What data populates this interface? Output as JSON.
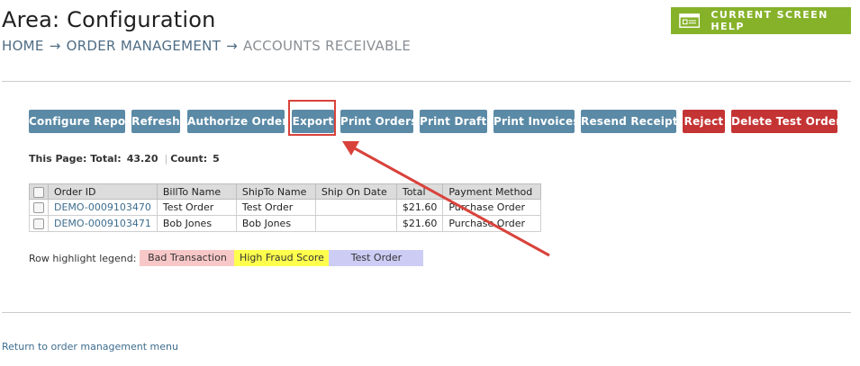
{
  "header": {
    "title": "Area: Configuration",
    "breadcrumb": {
      "home": "HOME",
      "separator": "→",
      "order_management": "ORDER MANAGEMENT",
      "current": "ACCOUNTS RECEIVABLE"
    },
    "help_button": {
      "label": "CURRENT SCREEN HELP",
      "icon": "screen-help-icon"
    }
  },
  "toolbar": {
    "configure_report": "Configure Report",
    "refresh": "Refresh",
    "authorize_orders": "Authorize Orders",
    "export": "Export",
    "print_orders": "Print Orders",
    "print_drafts": "Print Drafts",
    "print_invoices": "Print Invoices",
    "resend_receipts": "Resend Receipts",
    "reject": "Reject",
    "delete_test_orders": "Delete Test Orders"
  },
  "summary": {
    "total_label": "This Page: Total:",
    "total_value": "43.20",
    "count_label": "Count:",
    "count_value": "5"
  },
  "table": {
    "columns": [
      "Order ID",
      "BillTo Name",
      "ShipTo Name",
      "Ship On Date",
      "Total",
      "Payment Method"
    ],
    "rows": [
      {
        "order_id": "DEMO-0009103470",
        "billto": "Test Order",
        "shipto": "Test Order",
        "ship_on": "",
        "total": "$21.60",
        "payment": "Purchase Order"
      },
      {
        "order_id": "DEMO-0009103471",
        "billto": "Bob Jones",
        "shipto": "Bob Jones",
        "ship_on": "",
        "total": "$21.60",
        "payment": "Purchase Order"
      }
    ]
  },
  "legend": {
    "label": "Row highlight legend:",
    "items": [
      {
        "label": "Bad Transaction",
        "color": "#f8c8c8"
      },
      {
        "label": "High Fraud Score",
        "color": "#ffff4d"
      },
      {
        "label": "Test Order",
        "color": "#ccccf5"
      }
    ]
  },
  "footer": {
    "return_link": "Return to order management menu"
  },
  "colors": {
    "help_green": "#86b22a",
    "button_blue": "#5b8aa6",
    "button_red": "#c53434",
    "annotation_red": "#d9423b"
  }
}
